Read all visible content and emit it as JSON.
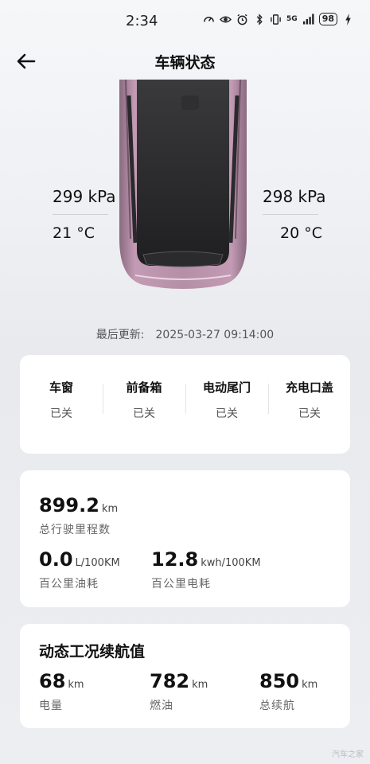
{
  "status_bar": {
    "time": "2:34",
    "network": "5G",
    "battery": "98",
    "icons": [
      "speedometer-icon",
      "eye-icon",
      "alarm-icon",
      "bluetooth-icon",
      "vibrate-icon",
      "signal-icon",
      "charging-icon"
    ]
  },
  "header": {
    "title": "车辆状态",
    "back_icon": "arrow-left-icon"
  },
  "tires": {
    "left": {
      "pressure": "299 kPa",
      "temp": "21 °C"
    },
    "right": {
      "pressure": "298 kPa",
      "temp": "20 °C"
    }
  },
  "car_color": "#b892a8",
  "last_update": {
    "label": "最后更新:",
    "value": "2025-03-27 09:14:00"
  },
  "status_items": [
    {
      "label": "车窗",
      "value": "已关"
    },
    {
      "label": "前备箱",
      "value": "已关"
    },
    {
      "label": "电动尾门",
      "value": "已关"
    },
    {
      "label": "充电口盖",
      "value": "已关"
    }
  ],
  "stats": {
    "odometer": {
      "value": "899.2",
      "unit": "km",
      "label": "总行驶里程数"
    },
    "fuel_consumption": {
      "value": "0.0",
      "unit": "L/100KM",
      "label": "百公里油耗"
    },
    "power_consumption": {
      "value": "12.8",
      "unit": "kwh/100KM",
      "label": "百公里电耗"
    }
  },
  "range": {
    "title": "动态工况续航值",
    "electric": {
      "value": "68",
      "unit": "km",
      "label": "电量"
    },
    "fuel": {
      "value": "782",
      "unit": "km",
      "label": "燃油"
    },
    "total": {
      "value": "850",
      "unit": "km",
      "label": "总续航"
    }
  },
  "watermark": "汽车之家"
}
